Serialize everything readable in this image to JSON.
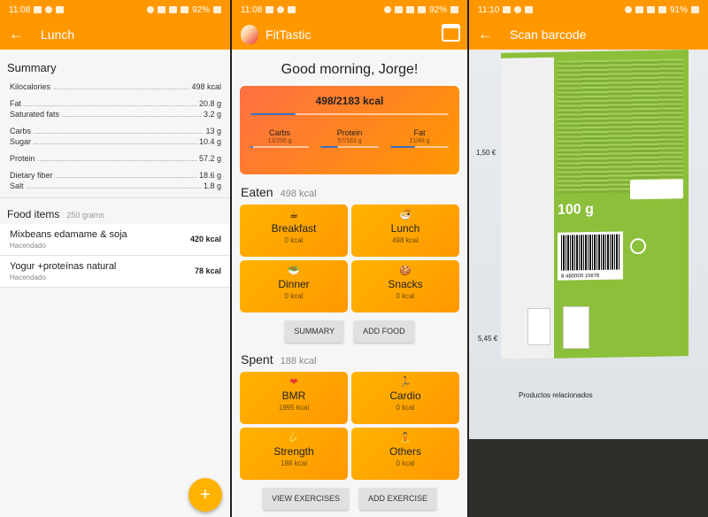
{
  "panel1": {
    "status": {
      "time": "11:08",
      "battery": "92%"
    },
    "appbar": {
      "back": "←",
      "title": "Lunch"
    },
    "summary_title": "Summary",
    "nutrients": [
      {
        "name": "Kilocalories",
        "value": "498 kcal"
      },
      {
        "name": "Fat",
        "value": "20.8 g"
      },
      {
        "name": "Saturated fats",
        "value": "3.2 g"
      },
      {
        "name": "Carbs",
        "value": "13 g"
      },
      {
        "name": "Sugar",
        "value": "10.4 g"
      },
      {
        "name": "Protein",
        "value": "57.2 g"
      },
      {
        "name": "Dietary fiber",
        "value": "18.6 g"
      },
      {
        "name": "Salt",
        "value": "1.8 g"
      }
    ],
    "food_items_title": "Food items",
    "food_items_sub": "250 grams",
    "foods": [
      {
        "name": "Mixbeans edamame & soja",
        "brand": "Hacendado",
        "kcal": "420 kcal"
      },
      {
        "name": "Yogur +proteínas natural",
        "brand": "Hacendado",
        "kcal": "78 kcal"
      }
    ],
    "fab": "+"
  },
  "panel2": {
    "status": {
      "time": "11:08",
      "battery": "92%"
    },
    "appbar": {
      "title": "FitTastic"
    },
    "greeting": "Good morning, Jorge!",
    "kcal_total": "498/2183 kcal",
    "kcal_fraction": 0.228,
    "macros": [
      {
        "label": "Carbs",
        "value": "13/256 g",
        "fraction": 0.05
      },
      {
        "label": "Protein",
        "value": "57/183 g",
        "fraction": 0.31
      },
      {
        "label": "Fat",
        "value": "21/48 g",
        "fraction": 0.43
      }
    ],
    "eaten": {
      "title": "Eaten",
      "sub": "498 kcal"
    },
    "meals": [
      {
        "icon": "☕",
        "label": "Breakfast",
        "value": "0 kcal"
      },
      {
        "icon": "🍜",
        "label": "Lunch",
        "value": "498 kcal"
      },
      {
        "icon": "🥗",
        "label": "Dinner",
        "value": "0 kcal"
      },
      {
        "icon": "🍪",
        "label": "Snacks",
        "value": "0 kcal"
      }
    ],
    "summary_btn": "SUMMARY",
    "add_food_btn": "ADD FOOD",
    "spent": {
      "title": "Spent",
      "sub": "188 kcal"
    },
    "exercises": [
      {
        "icon": "❤",
        "label": "BMR",
        "value": "1995 kcal"
      },
      {
        "icon": "🏃",
        "label": "Cardio",
        "value": "0 kcal"
      },
      {
        "icon": "💪",
        "label": "Strength",
        "value": "188 kcal"
      },
      {
        "icon": "🧘",
        "label": "Others",
        "value": "0 kcal"
      }
    ],
    "view_ex_btn": "VIEW EXERCISES",
    "add_ex_btn": "ADD EXERCISE"
  },
  "panel3": {
    "status": {
      "time": "11:10",
      "battery": "91%"
    },
    "appbar": {
      "back": "←",
      "title": "Scan barcode"
    },
    "camera": {
      "weight": "100 g",
      "barcode_digits": "8 480000 15676",
      "price1": "1,50 €",
      "price2": "5,45 €",
      "related": "Productos relacionados"
    }
  }
}
